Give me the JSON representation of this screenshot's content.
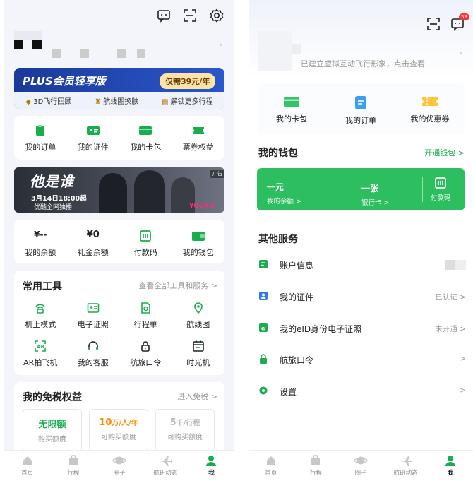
{
  "left": {
    "plus_banner": {
      "title": "PLUS会员轻享版",
      "price_badge": "仅需39元/年",
      "perks": [
        "3D飞行回顾",
        "航线图换肤",
        "解锁更多行程"
      ]
    },
    "quick_actions": [
      "我的订单",
      "我的证件",
      "我的卡包",
      "票券权益"
    ],
    "ad": {
      "title": "他是谁",
      "subtitle": "3月14日18:00起",
      "note": "优酷全网独播",
      "tag": "广告",
      "brand": "YOUKU"
    },
    "wallet": {
      "items": [
        {
          "value": "¥--",
          "label": "我的余额"
        },
        {
          "value": "¥0",
          "label": "礼金余额"
        },
        {
          "value": "",
          "label": "付款码"
        },
        {
          "value": "",
          "label": "我的钱包"
        }
      ]
    },
    "tools": {
      "title": "常用工具",
      "more": "查看全部工具和服务 >",
      "items": [
        "机上模式",
        "电子证照",
        "行程单",
        "航线图",
        "AR拍飞机",
        "我的客服",
        "航旅口令",
        "时光机"
      ]
    },
    "duty_free": {
      "title": "我的免税权益",
      "more": "进入免税 >",
      "cards": [
        {
          "value": "无限额",
          "unit": "",
          "label": "购买额度"
        },
        {
          "value": "10",
          "unit": "万/人/年",
          "label": "可购买额度"
        },
        {
          "value": "5",
          "unit": "千/行程",
          "label": "可购买额度"
        }
      ]
    },
    "tabbar": [
      "首页",
      "行程",
      "圈子",
      "航班动态",
      "我"
    ]
  },
  "right": {
    "notif_badge": "58",
    "profile_hint": "已建立虚拟互动飞行形象，点击查看",
    "top_items": [
      "我的卡包",
      "我的订单",
      "我的优惠券"
    ],
    "wallet": {
      "title": "我的钱包",
      "action": "开通钱包 >",
      "balance_value": "一元",
      "balance_label": "我的余额 >",
      "card_value": "一张",
      "card_label": "银行卡 >",
      "pay_label": "付款码"
    },
    "services": {
      "title": "其他服务",
      "items": [
        {
          "label": "账户信息",
          "status": ""
        },
        {
          "label": "我的证件",
          "status": "已认证 >"
        },
        {
          "label": "我的eID身份电子证照",
          "status": "未开通 >"
        },
        {
          "label": "航旅口令",
          "status": ">"
        },
        {
          "label": "设置",
          "status": ">"
        }
      ]
    },
    "tabbar": [
      "首页",
      "行程",
      "圈子",
      "航班动态",
      "我"
    ]
  },
  "colors": {
    "accent": "#1aad4e",
    "plus_bg": "#1c3d9e",
    "price_badge": "#ffe3a8",
    "orange": "#ff8a00"
  }
}
